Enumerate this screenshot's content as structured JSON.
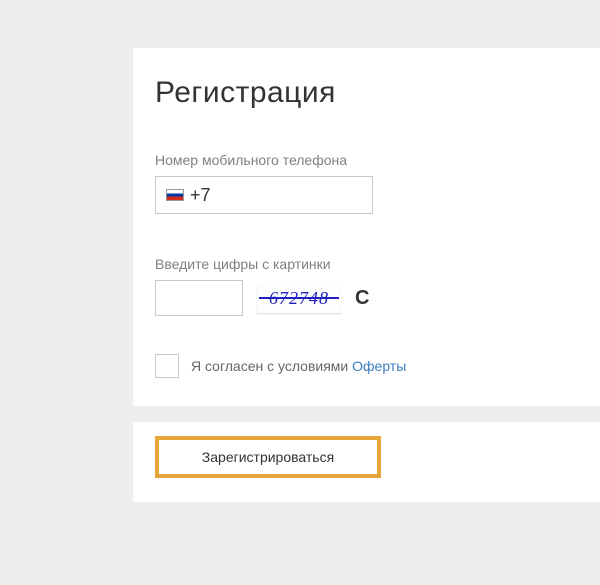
{
  "title": "Регистрация",
  "phone": {
    "label": "Номер мобильного телефона",
    "prefix": "+7",
    "flag": "ru"
  },
  "captcha": {
    "label": "Введите цифры с картинки",
    "image_value": "672748",
    "input_value": ""
  },
  "consent": {
    "text": "Я согласен с условиями ",
    "link_text": "Оферты",
    "checked": false
  },
  "submit": {
    "label": "Зарегистрироваться"
  },
  "colors": {
    "accent": "#e6a63b",
    "link": "#3b7dc0"
  }
}
